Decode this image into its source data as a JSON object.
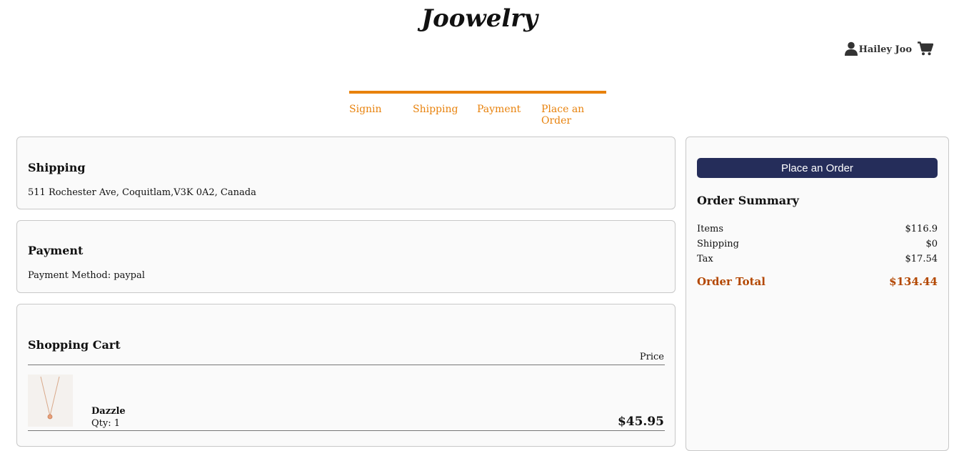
{
  "header": {
    "brand": "Joowelry",
    "user_name": "Hailey Joo",
    "user_icon": "user-icon",
    "cart_icon": "cart-icon"
  },
  "steps": [
    "Signin",
    "Shipping",
    "Payment",
    "Place an Order"
  ],
  "colors": {
    "accent": "#e8820c",
    "button": "#252d5a",
    "total": "#b34700"
  },
  "shipping": {
    "title": "Shipping",
    "address": "511 Rochester Ave, Coquitlam,V3K 0A2, Canada"
  },
  "payment": {
    "title": "Payment",
    "method": "Payment Method: paypal"
  },
  "cart": {
    "title": "Shopping Cart",
    "price_header": "Price",
    "items": [
      {
        "name": "Dazzle",
        "qty": "Qty: 1",
        "price": "$45.95"
      }
    ]
  },
  "summary": {
    "button": "Place an Order",
    "title": "Order Summary",
    "items_label": "Items",
    "items_value": "$116.9",
    "shipping_label": "Shipping",
    "shipping_value": "$0",
    "tax_label": "Tax",
    "tax_value": "$17.54",
    "total_label": "Order Total",
    "total_value": "$134.44"
  }
}
